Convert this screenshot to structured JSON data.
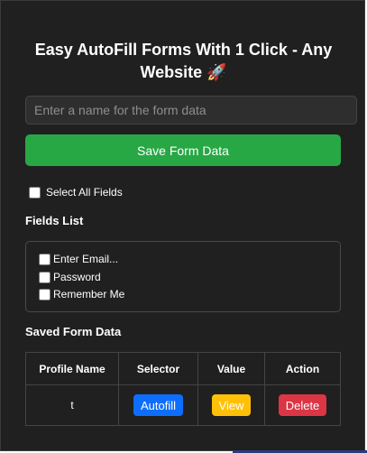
{
  "app": {
    "title": "Easy AutoFill Forms With 1 Click - Any Website 🚀"
  },
  "form": {
    "name_placeholder": "Enter a name for the form data",
    "name_value": "",
    "save_label": "Save Form Data"
  },
  "select_all": {
    "label": "Select All Fields",
    "checked": false
  },
  "fields_list": {
    "heading": "Fields List",
    "items": [
      {
        "label": "Enter Email...",
        "checked": false
      },
      {
        "label": "Password",
        "checked": false
      },
      {
        "label": "Remember Me",
        "checked": false
      }
    ]
  },
  "saved": {
    "heading": "Saved Form Data",
    "columns": [
      "Profile Name",
      "Selector",
      "Value",
      "Action"
    ],
    "rows": [
      {
        "profile_name": "t",
        "selector_label": "Autofill",
        "value_label": "View",
        "action_label": "Delete"
      }
    ]
  },
  "colors": {
    "background": "#202020",
    "save_button": "#28a745",
    "autofill_button": "#0d6efd",
    "view_button": "#ffc107",
    "delete_button": "#dc3545"
  }
}
